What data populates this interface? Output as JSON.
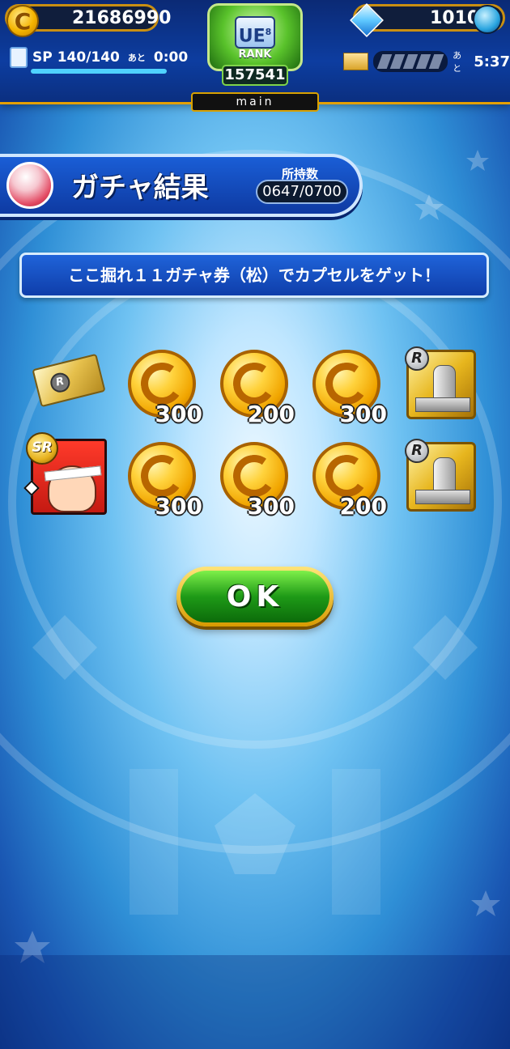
{
  "header": {
    "coins": "21686990",
    "gems": "10104",
    "sp_label": "SP",
    "sp_value": "140/140",
    "sp_ato": "あと",
    "sp_timer": "0:00",
    "sp_fill": 1.0,
    "rank_badge": "UE",
    "rank_sub": "8",
    "rank_label": "RANK",
    "rank_value": "157541",
    "tab_label": "main",
    "timer_ato": "あと",
    "timer_value": "5:37"
  },
  "title_banner": {
    "title": "ガチャ結果",
    "owned_label": "所持数",
    "owned_value": "0647/0700"
  },
  "message": "ここ掘れ１１ガチャ券（松）でカプセルをゲット！",
  "rewards": {
    "row1": [
      {
        "type": "ticket",
        "rarity": "R"
      },
      {
        "type": "coin",
        "amount": "300"
      },
      {
        "type": "coin",
        "amount": "200"
      },
      {
        "type": "coin",
        "amount": "300"
      },
      {
        "type": "trophy",
        "rarity": "R"
      }
    ],
    "row2": [
      {
        "type": "character",
        "rarity": "SR"
      },
      {
        "type": "coin",
        "amount": "300"
      },
      {
        "type": "coin",
        "amount": "300"
      },
      {
        "type": "coin",
        "amount": "200"
      },
      {
        "type": "trophy",
        "rarity": "R"
      }
    ]
  },
  "ok_label": "OK",
  "colors": {
    "accent_gold": "#d89a00",
    "header_blue": "#0d3da0",
    "ok_green": "#1e9a17"
  }
}
